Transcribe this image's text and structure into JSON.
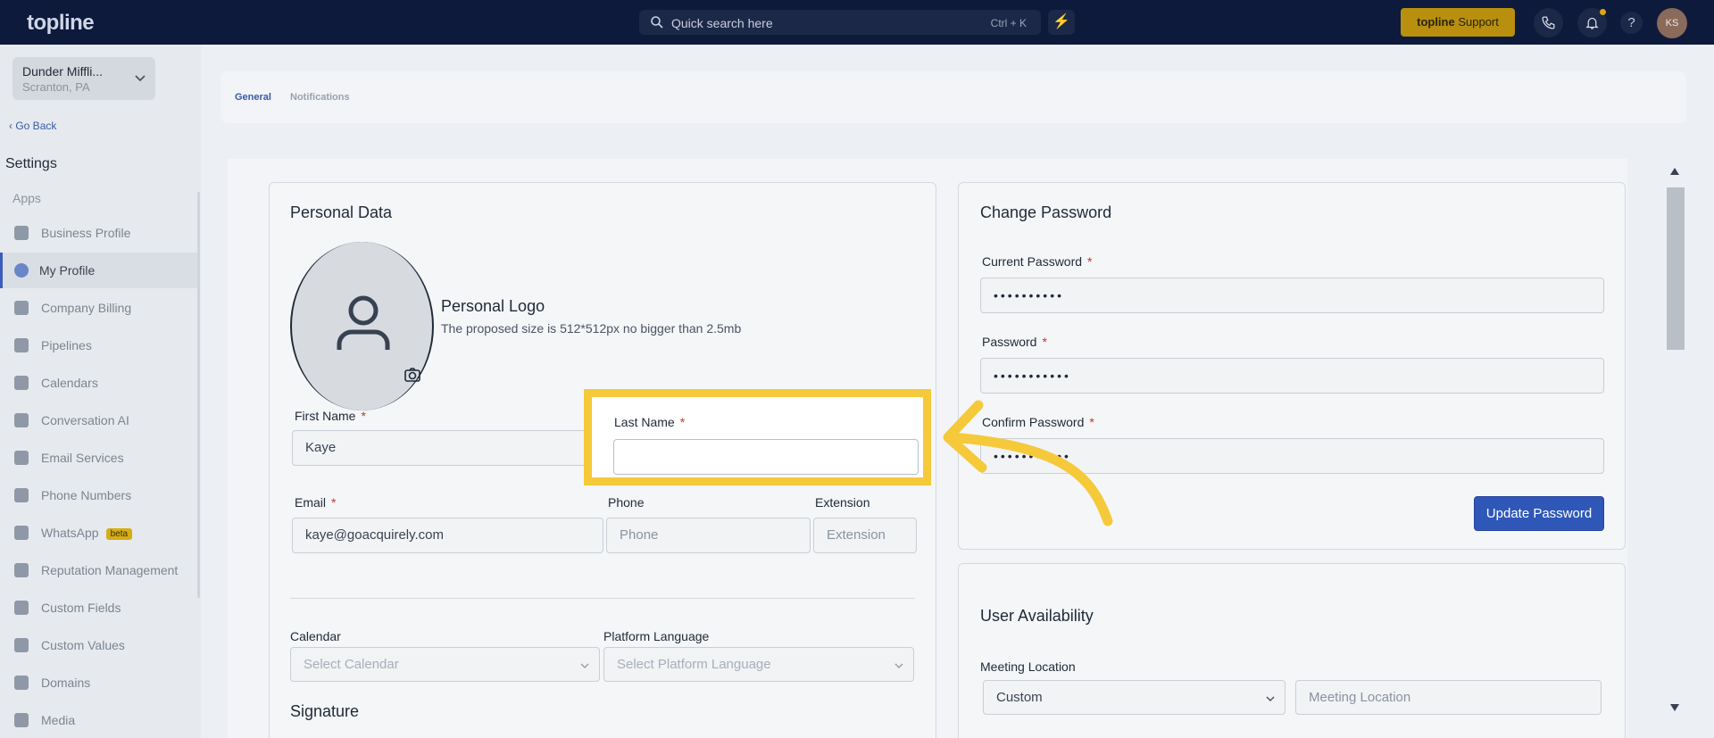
{
  "topbar": {
    "logo": "topline",
    "search_placeholder": "Quick search here",
    "search_shortcut": "Ctrl + K",
    "support_brand": "topline",
    "support_label": "Support",
    "help": "?",
    "avatar_initials": "KS"
  },
  "sidebar": {
    "business_name": "Dunder Miffli...",
    "business_location": "Scranton, PA",
    "go_back": "Go Back",
    "settings_heading": "Settings",
    "apps_heading": "Apps",
    "items": [
      {
        "label": "Business Profile",
        "icon": "briefcase-icon"
      },
      {
        "label": "My Profile",
        "icon": "user-icon",
        "active": true
      },
      {
        "label": "Company Billing",
        "icon": "grid-icon"
      },
      {
        "label": "Pipelines",
        "icon": "funnel-icon"
      },
      {
        "label": "Calendars",
        "icon": "calendar-icon"
      },
      {
        "label": "Conversation AI",
        "icon": "chat-icon"
      },
      {
        "label": "Email Services",
        "icon": "mail-icon"
      },
      {
        "label": "Phone Numbers",
        "icon": "phone-icon"
      },
      {
        "label": "WhatsApp",
        "icon": "whatsapp-icon",
        "badge": "beta"
      },
      {
        "label": "Reputation Management",
        "icon": "star-icon"
      },
      {
        "label": "Custom Fields",
        "icon": "edit-icon"
      },
      {
        "label": "Custom Values",
        "icon": "pie-icon"
      },
      {
        "label": "Domains",
        "icon": "domain-icon"
      },
      {
        "label": "Media",
        "icon": "video-icon"
      }
    ]
  },
  "tabs": {
    "general": "General",
    "notifications": "Notifications"
  },
  "personal": {
    "title": "Personal Data",
    "logo_title": "Personal Logo",
    "logo_hint": "The proposed size is 512*512px no bigger than 2.5mb",
    "first_name_label": "First Name",
    "first_name_value": "Kaye",
    "last_name_label": "Last Name",
    "last_name_value": "",
    "email_label": "Email",
    "email_value": "kaye@goacquirely.com",
    "phone_label": "Phone",
    "phone_placeholder": "Phone",
    "extension_label": "Extension",
    "extension_placeholder": "Extension",
    "calendar_label": "Calendar",
    "calendar_placeholder": "Select Calendar",
    "language_label": "Platform Language",
    "language_placeholder": "Select Platform Language",
    "signature_label": "Signature",
    "required_mark": "*"
  },
  "password": {
    "title": "Change Password",
    "current_label": "Current Password",
    "current_value": "••••••••••",
    "password_label": "Password",
    "password_value": "•••••••••••",
    "confirm_label": "Confirm Password",
    "confirm_value": "•••••••••••",
    "update_button": "Update Password"
  },
  "availability": {
    "title": "User Availability",
    "meeting_location_label": "Meeting Location",
    "meeting_location_select": "Custom",
    "meeting_location_placeholder": "Meeting Location"
  },
  "colors": {
    "highlight": "#f5c93a",
    "primary_button": "#2f57b8",
    "topbar": "#0e1a3b",
    "support_button": "#b88f0e"
  }
}
